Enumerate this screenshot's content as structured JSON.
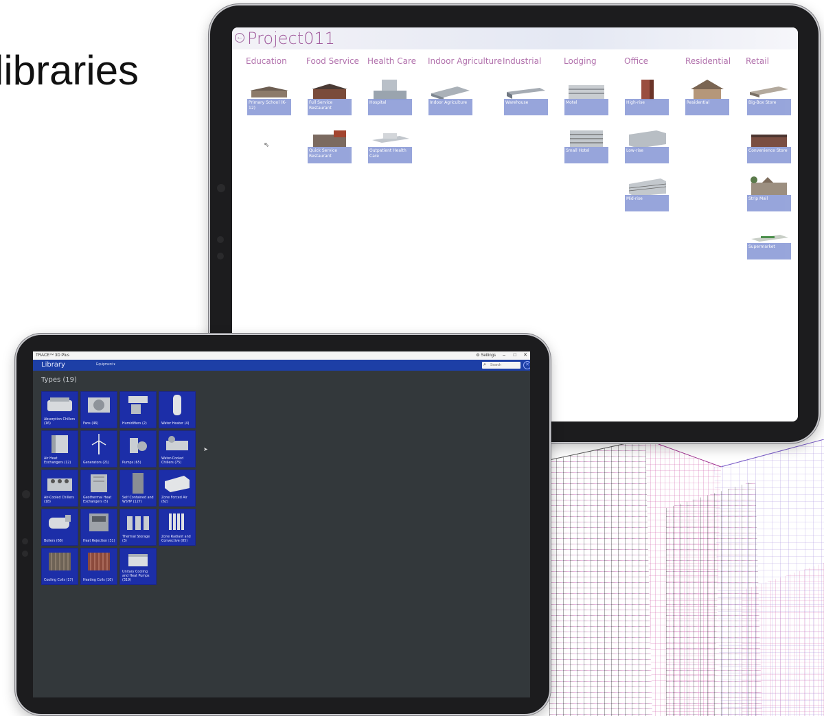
{
  "slide": {
    "title": "libraries"
  },
  "project_app": {
    "title": "Project011",
    "categories": [
      {
        "label": "Education",
        "buildings": [
          "Primary School (K-12)"
        ]
      },
      {
        "label": "Food Service",
        "buildings": [
          "Full Service Restaurant",
          "Quick Service Restaurant"
        ]
      },
      {
        "label": "Health Care",
        "buildings": [
          "Hospital",
          "Outpatient Health Care"
        ]
      },
      {
        "label": "Indoor Agriculture",
        "buildings": [
          "Indoor Agriculture"
        ]
      },
      {
        "label": "Industrial",
        "buildings": [
          "Warehouse"
        ]
      },
      {
        "label": "Lodging",
        "buildings": [
          "Motel",
          "Small Hotel"
        ]
      },
      {
        "label": "Office",
        "buildings": [
          "High-rise",
          "Low-rise",
          "Mid-rise"
        ]
      },
      {
        "label": "Residential",
        "buildings": [
          "Residential"
        ]
      },
      {
        "label": "Retail",
        "buildings": [
          "Big-Box Store",
          "Convenience Store",
          "Strip Mall",
          "Supermarket"
        ]
      }
    ]
  },
  "library_app": {
    "window_title": "TRACE™ 3D Plus",
    "settings_label": "Settings",
    "minimize": "–",
    "maximize": "□",
    "close": "✕",
    "header_title": "Library",
    "dropdown_label": "Equipment",
    "search_placeholder": "Search",
    "types_heading": "Types (19)",
    "tiles": [
      [
        "Absorption Chillers (16)",
        "Fans (46)",
        "Humidifiers (2)",
        "Water Heater (4)"
      ],
      [
        "Air Heat Exchangers (12)",
        "Generators (21)",
        "Pumps (65)",
        "Water-Cooled Chillers (75)"
      ],
      [
        "Air-Cooled Chillers (18)",
        "Geothermal Heat Exchangers (5)",
        "Self Contained and WSHP (127)",
        "Zone Forced Air (62)"
      ],
      [
        "Boilers (68)",
        "Heat Rejection (31)",
        "Thermal Storage (3)",
        "Zone Radiant and Convective (85)"
      ],
      [
        "Cooling Coils (17)",
        "Heating Coils (10)",
        "Unitary Cooling and Heat Pumps (319)"
      ]
    ]
  },
  "icons": {
    "back": "back-arrow-icon",
    "search": "search-icon",
    "close": "close-circle-icon",
    "cursor": "mouse-pointer-icon",
    "settings": "gear-icon"
  },
  "colors": {
    "project_accent": "#a05a9c",
    "tile_label_bg": "#8f9ed8",
    "library_header": "#1d3fa6",
    "library_bg": "#33383b",
    "equip_tile": "#1c2ea8"
  }
}
